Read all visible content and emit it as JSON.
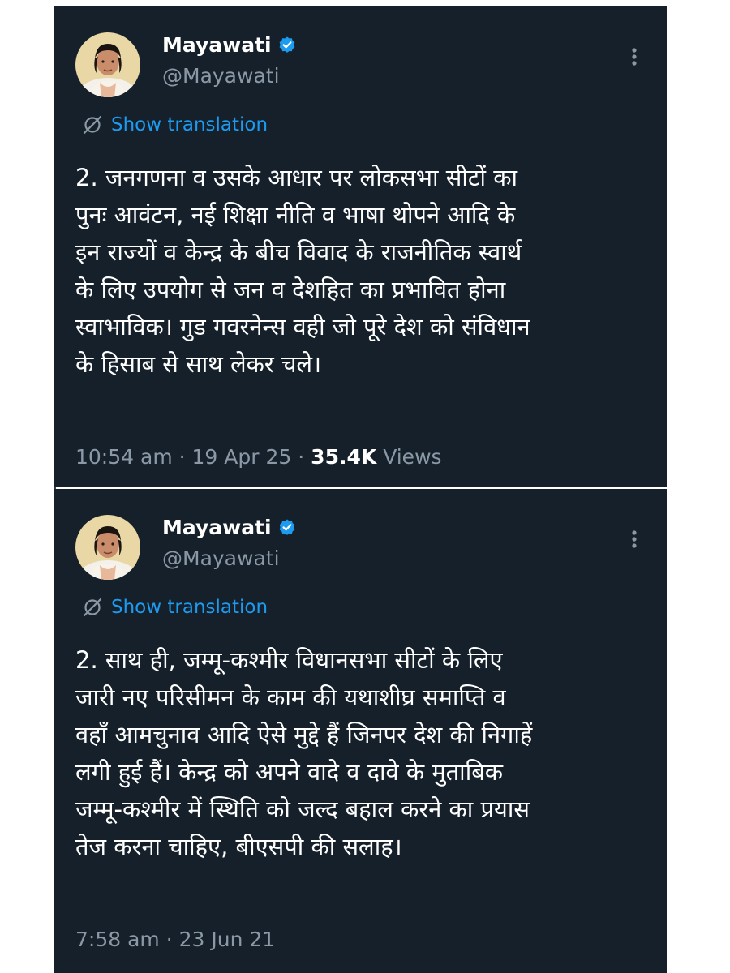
{
  "tweets": [
    {
      "display_name": "Mayawati",
      "handle": "@Mayawati",
      "translation_label": "Show translation",
      "body_lines": [
        "2. जनगणना व उसके आधार पर लोकसभा सीटों का",
        "पुनः आवंटन, नई शिक्षा नीति व भाषा थोपने आदि के",
        "इन राज्यों व केन्द्र के बीच विवाद के राजनीतिक स्वार्थ",
        "के लिए उपयोग से जन व देशहित का प्रभावित होना",
        "स्वाभाविक। गुड गवरनेन्स वही जो पूरे देश को संविधान",
        "के हिसाब से साथ लेकर चले।"
      ],
      "time": "10:54 am",
      "date": "19 Apr 25",
      "views_count": "35.4K",
      "views_label": "Views"
    },
    {
      "display_name": "Mayawati",
      "handle": "@Mayawati",
      "translation_label": "Show translation",
      "body_lines": [
        "2. साथ ही, जम्मू-कश्मीर विधानसभा सीटों के लिए",
        "जारी नए परिसीमन के काम की यथाशीघ्र समाप्ति व",
        "वहाँ आमचुनाव आदि ऐसे मुद्दे हैं जिनपर देश की निगाहें",
        "लगी हुई हैं। केन्द्र को अपने वादे व दावे के मुताबिक",
        "जम्मू-कश्मीर में स्थिति को जल्द बहाल करने का प्रयास",
        "तेज करना चाहिए, बीएसपी की सलाह।"
      ],
      "time": "7:58 am",
      "date": "23 Jun 21"
    }
  ],
  "separator": "·",
  "colors": {
    "background": "#15202b",
    "text_primary": "#ffffff",
    "text_secondary": "#8b98a5",
    "accent": "#1d9bf0",
    "verified_badge": "#1d9bf0"
  },
  "icons": {
    "verified": "verified-badge-icon",
    "more": "more-options-icon",
    "translate": "translate-icon",
    "avatar": "profile-photo"
  }
}
